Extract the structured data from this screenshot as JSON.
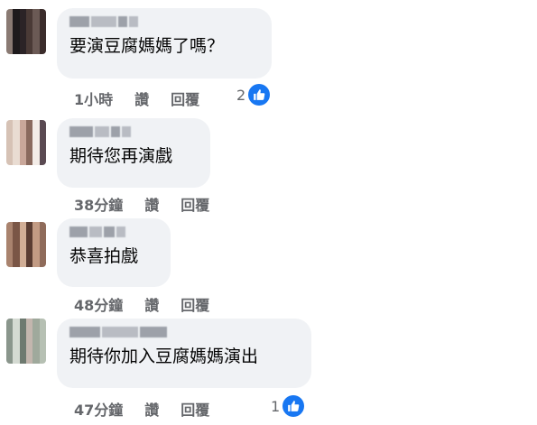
{
  "comments": [
    {
      "text": "要演豆腐媽媽了嗎？",
      "time": "1小時",
      "like_label": "讚",
      "reply_label": "回覆",
      "reaction_count": "2"
    },
    {
      "text": "期待您再演戲",
      "time": "38分鐘",
      "like_label": "讚",
      "reply_label": "回覆",
      "reaction_count": null
    },
    {
      "text": "恭喜拍戲",
      "time": "48分鐘",
      "like_label": "讚",
      "reply_label": "回覆",
      "reaction_count": null
    },
    {
      "text": "期待你加入豆腐媽媽演出",
      "time": "47分鐘",
      "like_label": "讚",
      "reply_label": "回覆",
      "reaction_count": "1"
    }
  ],
  "icons": {
    "reaction": "thumbs-up-icon"
  },
  "colors": {
    "bubble": "#f0f2f5",
    "meta": "#65676b",
    "like_blue": "#1877f2"
  }
}
